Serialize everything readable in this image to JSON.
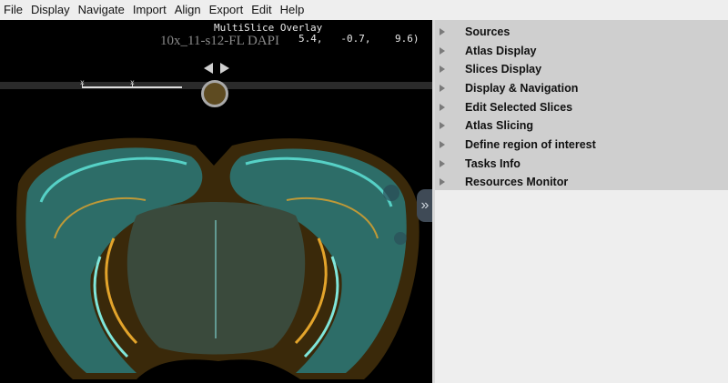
{
  "menu": [
    "File",
    "Display",
    "Navigate",
    "Import",
    "Align",
    "Export",
    "Edit",
    "Help"
  ],
  "viewer": {
    "overlay_title": "MultiSlice Overlay",
    "slice_name": "10x_11-s12-FL DAPI",
    "coords": "5.4,   -0.7,    9.6)",
    "scalebar_labels": [
      "x",
      "x"
    ],
    "expand_glyph": "»"
  },
  "panel": {
    "items": [
      "Sources",
      "Atlas Display",
      "Slices Display",
      "Display & Navigation",
      "Edit Selected Slices",
      "Atlas Slicing",
      "Define region of interest",
      "Tasks Info",
      "Resources Monitor"
    ]
  },
  "colors": {
    "tissue_cyan": "#3fb9b0",
    "tissue_orange": "#c8891d",
    "panel_bg": "#cfcfcf"
  }
}
